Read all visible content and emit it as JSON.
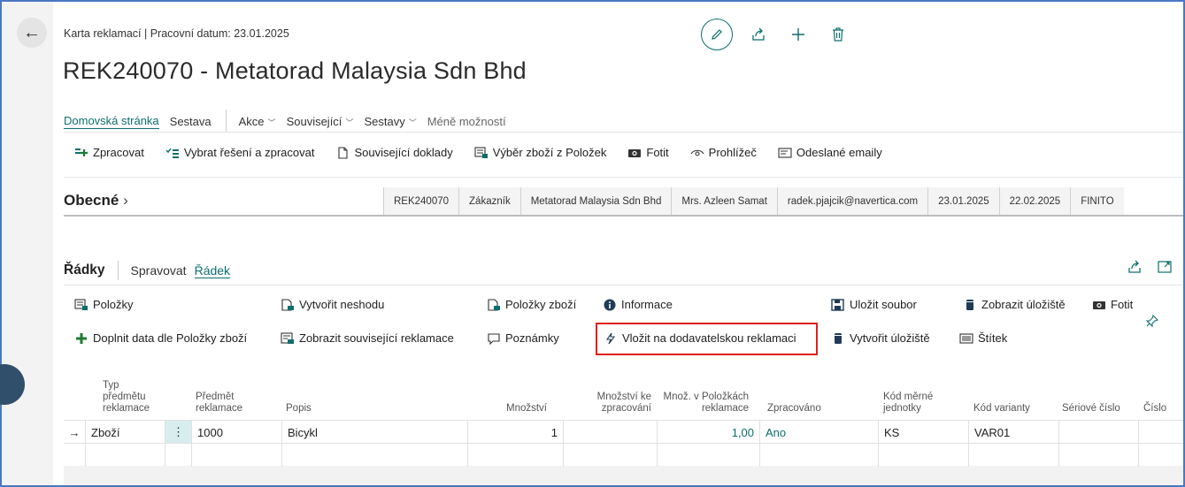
{
  "header": {
    "breadcrumb": "Karta reklamací | Pracovní datum: 23.01.2025",
    "title": "REK240070 - Metatorad Malaysia Sdn Bhd"
  },
  "actionbar": {
    "home": "Domovská stránka",
    "report": "Sestava",
    "actions": "Akce",
    "related": "Související",
    "reports": "Sestavy",
    "fewer": "Méně možností"
  },
  "promoted": [
    "Zpracovat",
    "Vybrat řešení a zpracovat",
    "Související doklady",
    "Výběr zboží z Položek",
    "Fotit",
    "Prohlížeč",
    "Odeslané emaily"
  ],
  "general": {
    "title": "Obecné",
    "chevron": "›",
    "facts": [
      "REK240070",
      "Zákazník",
      "Metatorad Malaysia Sdn Bhd",
      "Mrs. Azleen Samat",
      "radek.pjajcik@navertica.com",
      "23.01.2025",
      "22.02.2025",
      "FINITO"
    ]
  },
  "lines": {
    "title": "Řádky",
    "manage": "Spravovat",
    "line": "Řádek",
    "actions_row1": [
      "Položky",
      "Vytvořit neshodu",
      "Položky zboží",
      "Informace",
      "Uložit soubor",
      "Zobrazit úložiště",
      "Fotit"
    ],
    "actions_row2": [
      "Doplnit data dle Položky zboží",
      "Zobrazit související reklamace",
      "Poznámky",
      "Vložit na dodavatelskou reklamaci",
      "Vytvořit úložiště",
      "Štítek"
    ]
  },
  "table": {
    "columns": {
      "type_l1": "Typ",
      "type_l2": "předmětu",
      "type_l3": "reklamace",
      "subject_l1": "Předmět",
      "subject_l2": "reklamace",
      "desc": "Popis",
      "qty": "Množství",
      "qty_proc_l1": "Množství ke",
      "qty_proc_l2": "zpracování",
      "qty_items_l1": "Množ. v Položkách",
      "qty_items_l2": "reklamace",
      "processed": "Zpracováno",
      "uom_l1": "Kód měrné",
      "uom_l2": "jednotky",
      "variant": "Kód varianty",
      "serial": "Sériové číslo",
      "number": "Číslo"
    },
    "row": {
      "arrow": "→",
      "type": "Zboží",
      "menu": "⋮",
      "subject": "1000",
      "desc": "Bicykl",
      "qty": "1",
      "qty_proc": "",
      "qty_items": "1,00",
      "processed": "Ano",
      "uom": "KS",
      "variant": "VAR01",
      "serial": "",
      "number": ""
    }
  },
  "colors": {
    "accent": "#0e6e6e",
    "highlight_border": "#e0201e",
    "green_plus": "#1e7a32"
  }
}
